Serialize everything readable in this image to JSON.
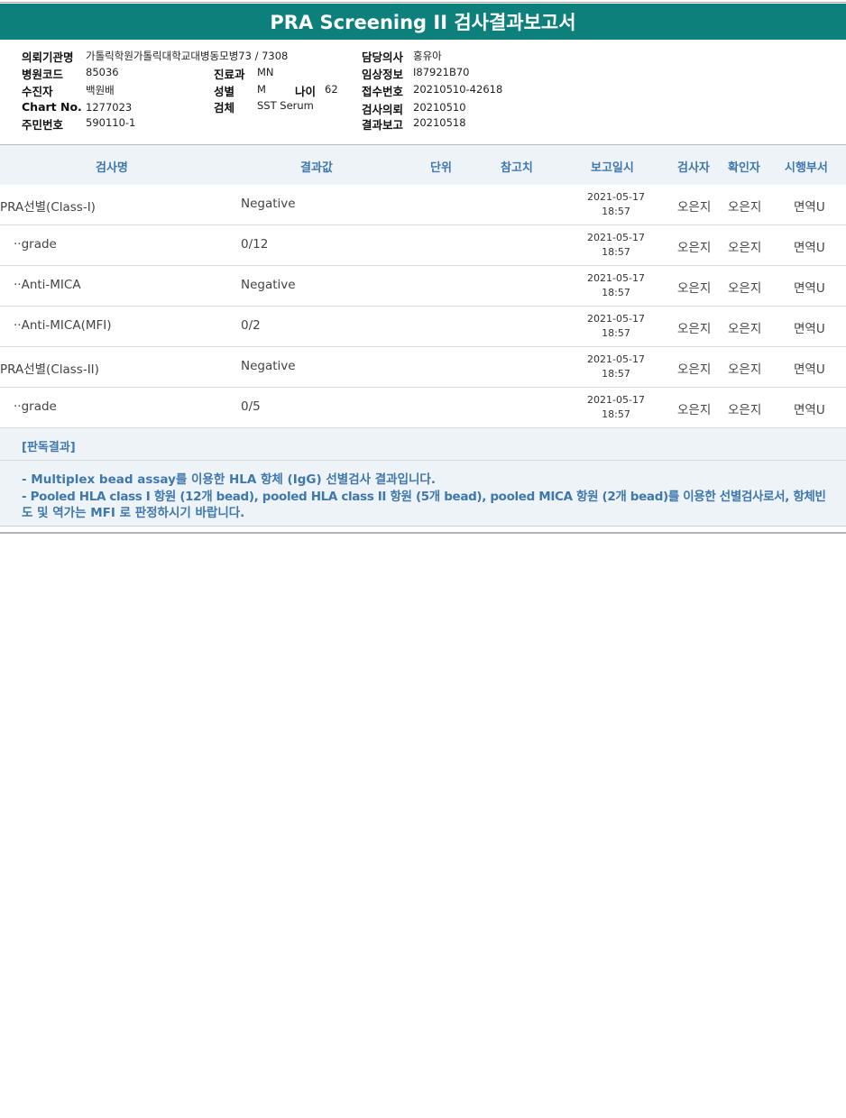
{
  "title": "PRA Screening II 검사결과보고서",
  "info": {
    "institution_label": "의뢰기관명",
    "institution_value": "가톨릭학원가톨릭대학교대병동모병73 / 7308",
    "doctor_label": "담당의사",
    "doctor_value": "홍유아",
    "hospital_code_label": "병원코드",
    "hospital_code_value": "85036",
    "department_label": "진료과",
    "department_value": "MN",
    "clinical_label": "임상정보",
    "clinical_value": "I87921B70",
    "patient_label": "수진자",
    "patient_value": "백원배",
    "sex_label": "성별",
    "sex_value": "M",
    "age_label": "나이",
    "age_value": "62",
    "receipt_label": "접수번호",
    "receipt_value": "20210510-42618",
    "chart_label": "Chart No.",
    "chart_value": "1277023",
    "specimen_label": "검체",
    "specimen_value": "SST Serum",
    "request_label": "검사의뢰",
    "request_value": "20210510",
    "id_label": "주민번호",
    "id_value": "590110-1",
    "report_label": "결과보고",
    "report_value": "20210518"
  },
  "table": {
    "headers": {
      "test_name": "검사명",
      "result": "결과값",
      "unit": "단위",
      "reference": "참고치",
      "report_time": "보고일시",
      "tester": "검사자",
      "confirmer": "확인자",
      "dept": "시행부서"
    },
    "rows": [
      {
        "name": "PRA선별(Class-I)",
        "result": "Negative",
        "date": "2021-05-17",
        "time": "18:57",
        "tester": "오은지",
        "confirmer": "오은지",
        "dept": "면역U"
      },
      {
        "name": "··grade",
        "result": "0/12",
        "date": "2021-05-17",
        "time": "18:57",
        "tester": "오은지",
        "confirmer": "오은지",
        "dept": "면역U"
      },
      {
        "name": "··Anti-MICA",
        "result": "Negative",
        "date": "2021-05-17",
        "time": "18:57",
        "tester": "오은지",
        "confirmer": "오은지",
        "dept": "면역U"
      },
      {
        "name": "··Anti-MICA(MFI)",
        "result": "0/2",
        "date": "2021-05-17",
        "time": "18:57",
        "tester": "오은지",
        "confirmer": "오은지",
        "dept": "면역U"
      },
      {
        "name": "PRA선별(Class-II)",
        "result": "Negative",
        "date": "2021-05-17",
        "time": "18:57",
        "tester": "오은지",
        "confirmer": "오은지",
        "dept": "면역U"
      },
      {
        "name": "··grade",
        "result": "0/5",
        "date": "2021-05-17",
        "time": "18:57",
        "tester": "오은지",
        "confirmer": "오은지",
        "dept": "면역U"
      }
    ]
  },
  "interpretation": {
    "title": "[판독결과]",
    "line1": "- Multiplex bead assay를 이용한 HLA 항체 (IgG) 선별검사 결과입니다.",
    "line2": "- Pooled HLA class I 항원 (12개 bead), pooled HLA class II 항원 (5개 bead), pooled MICA 항원 (2개 bead)를 이용한 선별검사로서, 항체빈",
    "line3": "도 및 역가는 MFI 로 판정하시기 바랍니다."
  }
}
